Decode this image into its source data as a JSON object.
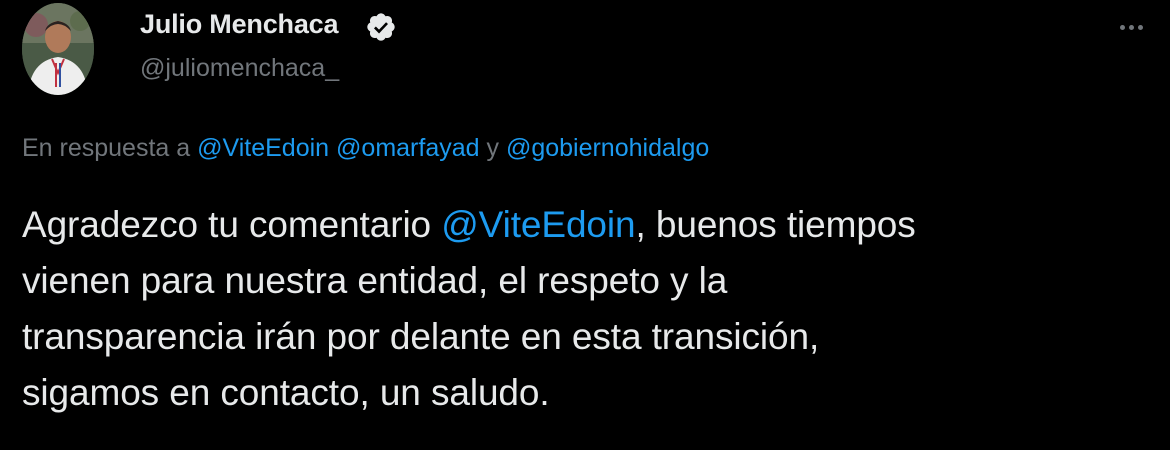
{
  "author": {
    "display_name": "Julio Menchaca",
    "handle": "@juliomenchaca_",
    "verified": true
  },
  "reply_to": {
    "prefix": "En respuesta a ",
    "mention_1": "@ViteEdoin",
    "space_1": " ",
    "mention_2": "@omarfayad",
    "conjunction": " y ",
    "mention_3": "@gobiernohidalgo"
  },
  "tweet": {
    "line1_before": "Agradezco tu comentario ",
    "line1_mention": "@ViteEdoin",
    "line1_after": ", buenos tiempos",
    "line2": "vienen para nuestra entidad, el respeto y la",
    "line3": "transparencia irán por delante en esta transición,",
    "line4": "sigamos en contacto, un saludo."
  },
  "colors": {
    "background": "#000000",
    "text": "#e7e9ea",
    "secondary": "#71767b",
    "link": "#1d9bf0"
  },
  "icons": [
    "verified-badge-icon",
    "more-options-icon"
  ]
}
